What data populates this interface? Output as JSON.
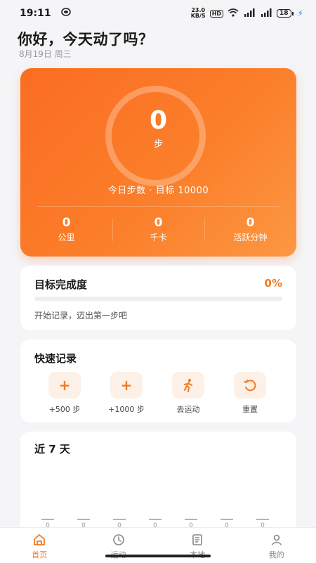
{
  "status": {
    "time": "19:11",
    "net_speed_value": "23.0",
    "net_speed_unit": "KB/S",
    "hd": "HD",
    "sig1": "4G",
    "sig2": "4G",
    "battery": "18"
  },
  "header": {
    "greeting": "你好，今天动了吗？",
    "date": "8月19日 周三"
  },
  "today": {
    "steps": "0",
    "steps_unit": "步",
    "goal_line": "今日步数 · 目标 10000",
    "metrics": [
      {
        "value": "0",
        "label": "公里"
      },
      {
        "value": "0",
        "label": "千卡"
      },
      {
        "value": "0",
        "label": "活跃分钟"
      }
    ]
  },
  "goal": {
    "title": "目标完成度",
    "percent_text": "0%",
    "progress_fraction": 0,
    "hint": "开始记录，迈出第一步吧"
  },
  "quick": {
    "title": "快速记录",
    "items": [
      {
        "label": "+500 步",
        "icon": "plus-icon"
      },
      {
        "label": "+1000 步",
        "icon": "plus-icon"
      },
      {
        "label": "去运动",
        "icon": "running-person-icon"
      },
      {
        "label": "重置",
        "icon": "reset-icon"
      }
    ]
  },
  "week": {
    "title": "近 7 天",
    "values": [
      0,
      0,
      0,
      0,
      0,
      0,
      0
    ]
  },
  "tabs": [
    {
      "label": "首页",
      "icon": "home-icon",
      "active": true
    },
    {
      "label": "运动",
      "icon": "clock-icon",
      "active": false
    },
    {
      "label": "本地",
      "icon": "document-icon",
      "active": false
    },
    {
      "label": "我的",
      "icon": "person-icon",
      "active": false
    }
  ],
  "colors": {
    "accent": "#f07a24",
    "hero_start": "#fb6d22",
    "hero_end": "#fd9742"
  }
}
